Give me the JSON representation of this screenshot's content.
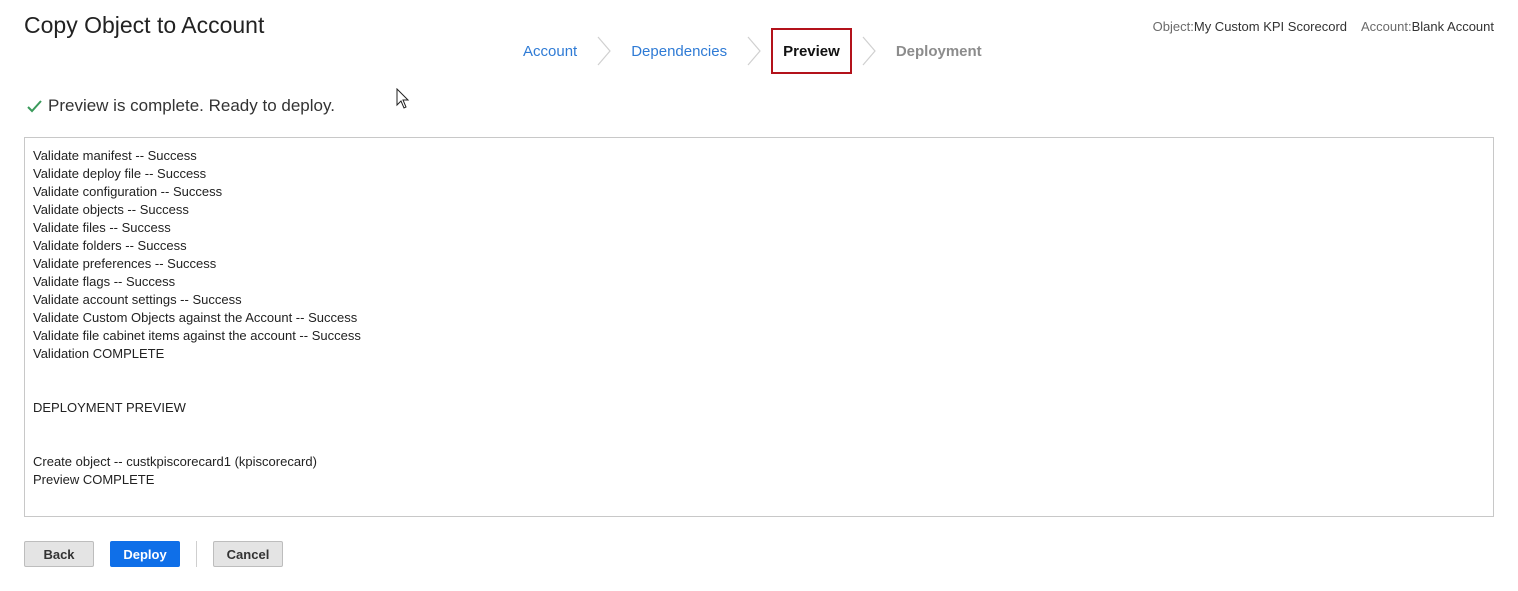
{
  "header": {
    "title": "Copy Object to Account",
    "object_key": "Object:",
    "object_value": "My Custom KPI Scorecord",
    "account_key": "Account:",
    "account_value": "Blank Account"
  },
  "steps": [
    {
      "label": "Account",
      "state": "completed"
    },
    {
      "label": "Dependencies",
      "state": "completed"
    },
    {
      "label": "Preview",
      "state": "current"
    },
    {
      "label": "Deployment",
      "state": "upcoming"
    }
  ],
  "status": {
    "icon": "check-icon",
    "message": "Preview is complete. Ready to deploy."
  },
  "log": {
    "lines": [
      "Validate manifest -- Success",
      "Validate deploy file -- Success",
      "Validate configuration -- Success",
      "Validate objects -- Success",
      "Validate files -- Success",
      "Validate folders -- Success",
      "Validate preferences -- Success",
      "Validate flags -- Success",
      "Validate account settings -- Success",
      "Validate Custom Objects against the Account -- Success",
      "Validate file cabinet items against the account -- Success",
      "Validation COMPLETE",
      "",
      "",
      "DEPLOYMENT PREVIEW",
      "",
      "",
      "Create object -- custkpiscorecard1 (kpiscorecard)",
      "Preview COMPLETE"
    ]
  },
  "buttons": {
    "back": "Back",
    "deploy": "Deploy",
    "cancel": "Cancel"
  },
  "colors": {
    "link": "#2f7bd5",
    "current_step_border": "#b3121b",
    "primary_button": "#0f6fe8",
    "check": "#3a9a5b"
  }
}
